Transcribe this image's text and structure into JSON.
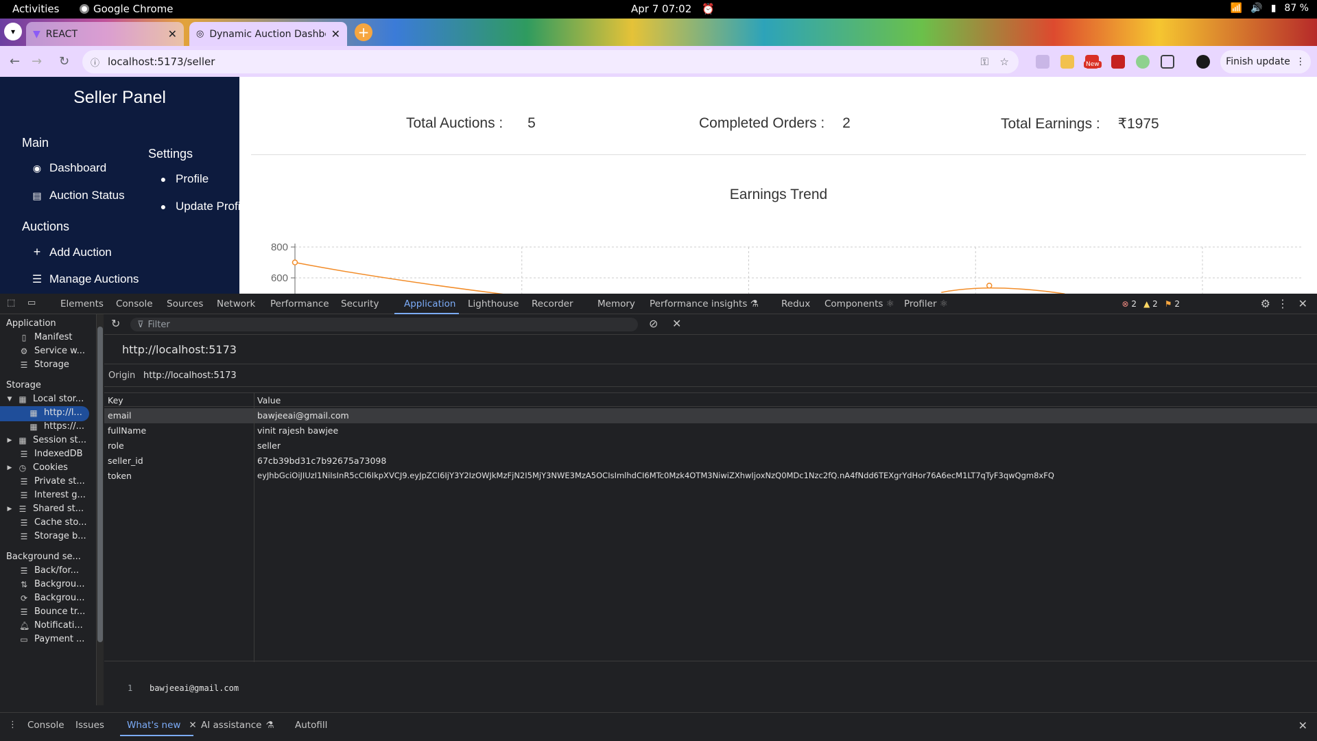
{
  "system_bar": {
    "activities": "Activities",
    "app_name": "Google Chrome",
    "clock": "Apr 7  07:02",
    "battery": "87 %"
  },
  "browser": {
    "tabs": [
      {
        "title": "REACT",
        "icon": "vite-icon"
      },
      {
        "title": "Dynamic Auction Dashbo",
        "icon": "globe-icon"
      }
    ],
    "url": "localhost:5173/seller",
    "finish_update": "Finish update",
    "new_badge": "New"
  },
  "seller_page": {
    "sidebar": {
      "title": "Seller Panel",
      "main_heading": "Main",
      "main_items": [
        {
          "label": "Dashboard",
          "icon": "dashboard-icon"
        },
        {
          "label": "Auction Status",
          "icon": "clipboard-icon"
        }
      ],
      "settings_heading": "Settings",
      "settings_items": [
        {
          "label": "Profile",
          "icon": "user-icon"
        },
        {
          "label": "Update Profil",
          "icon": "user-edit-icon"
        }
      ],
      "auctions_heading": "Auctions",
      "auction_items": [
        {
          "label": "Add Auction",
          "icon": "plus-icon"
        },
        {
          "label": "Manage Auctions",
          "icon": "list-icon"
        }
      ]
    },
    "stats": [
      {
        "label": "Total Auctions :",
        "value": "5"
      },
      {
        "label": "Completed Orders :",
        "value": "2"
      },
      {
        "label": "Total Earnings :",
        "value": "₹1975"
      }
    ],
    "chart_data": {
      "type": "line",
      "title": "Earnings Trend",
      "y_ticks": [
        "800",
        "600"
      ],
      "ylim": [
        0,
        800
      ],
      "series_color": "#f28c28",
      "visible_points": [
        700,
        null,
        null,
        550
      ],
      "grid": true
    }
  },
  "devtools": {
    "tabs": [
      "Elements",
      "Console",
      "Sources",
      "Network",
      "Performance",
      "Security",
      "Application",
      "Lighthouse",
      "Recorder",
      "Memory",
      "Performance insights",
      "Redux",
      "Components",
      "Profiler"
    ],
    "active_tab": "Application",
    "issue_counts": {
      "errors": "2",
      "warnings": "2",
      "info": "2"
    },
    "sidebar": {
      "application_heading": "Application",
      "application_items": [
        "Manifest",
        "Service w...",
        "Storage"
      ],
      "storage_heading": "Storage",
      "storage_items": [
        {
          "label": "Local stor...",
          "expanded": true
        },
        {
          "label": "http://l...",
          "selected": true
        },
        {
          "label": "https://..."
        },
        {
          "label": "Session st...",
          "collapsed": true
        },
        {
          "label": "IndexedDB"
        },
        {
          "label": "Cookies",
          "collapsed": true
        },
        {
          "label": "Private st..."
        },
        {
          "label": "Interest g..."
        },
        {
          "label": "Shared st...",
          "collapsed": true
        },
        {
          "label": "Cache sto..."
        },
        {
          "label": "Storage b..."
        }
      ],
      "background_heading": "Background se...",
      "background_items": [
        "Back/for...",
        "Backgrou...",
        "Backgrou...",
        "Bounce tr...",
        "Notificati...",
        "Payment ..."
      ]
    },
    "filter_placeholder": "Filter",
    "origin_title": "http://localhost:5173",
    "origin_label": "Origin",
    "origin_value": "http://localhost:5173",
    "table": {
      "headers": [
        "Key",
        "Value"
      ],
      "rows": [
        {
          "key": "email",
          "value": "bawjeeai@gmail.com"
        },
        {
          "key": "fullName",
          "value": "vinit rajesh bawjee"
        },
        {
          "key": "role",
          "value": "seller"
        },
        {
          "key": "seller_id",
          "value": "67cb39bd31c7b92675a73098"
        },
        {
          "key": "token",
          "value": "eyJhbGciOiJIUzI1NiIsInR5cCI6IkpXVCJ9.eyJpZCI6IjY3Y2IzOWJkMzFjN2I5MjY3NWE3MzA5OCIsImlhdCI6MTc0Mzk4OTM3NiwiZXhwIjoxNzQ0MDc1Nzc2fQ.nA4fNdd6TEXgrYdHor76A6ecM1LT7qTyF3qwQgm8xFQ"
        }
      ]
    },
    "preview": {
      "line_no": "1",
      "text": "bawjeeai@gmail.com"
    },
    "drawer_tabs": [
      {
        "label": "Console"
      },
      {
        "label": "Issues"
      },
      {
        "label": "What's new",
        "active": true
      },
      {
        "label": "AI assistance"
      },
      {
        "label": "Autofill"
      }
    ]
  }
}
